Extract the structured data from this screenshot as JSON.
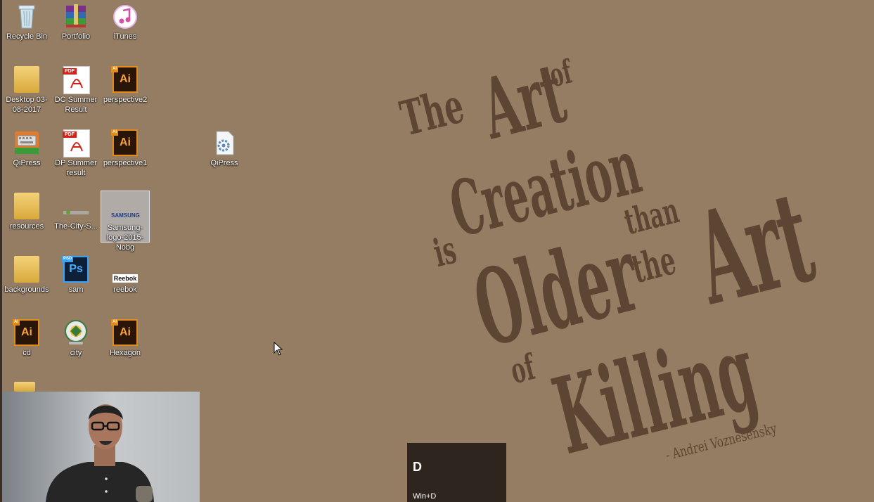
{
  "desktop": {
    "icons": [
      {
        "label": "Recycle Bin",
        "icon": "recycle-bin-icon"
      },
      {
        "label": "Portfolio",
        "icon": "winrar-archive-icon"
      },
      {
        "label": "iTunes",
        "icon": "itunes-icon"
      },
      {
        "label": "Desktop 03-08-2017",
        "icon": "folder-icon"
      },
      {
        "label": "DC Summer Result",
        "icon": "pdf-file-icon",
        "tag": "PDF"
      },
      {
        "label": "perspective2",
        "icon": "illustrator-file-icon",
        "tag": "AI",
        "glyph": "Ai"
      },
      {
        "label": "QiPress",
        "icon": "keyboard-app-icon"
      },
      {
        "label": "DP Summer result",
        "icon": "pdf-file-icon",
        "tag": "PDF"
      },
      {
        "label": "perspective1",
        "icon": "illustrator-file-icon",
        "tag": "AI",
        "glyph": "Ai"
      },
      {
        "label": "QiPress",
        "icon": "settings-file-icon"
      },
      {
        "label": "resources",
        "icon": "folder-icon"
      },
      {
        "label": "The-City-S...",
        "icon": "image-thumbnail-icon"
      },
      {
        "label": "Samsung-logo-2015-Nobg",
        "icon": "samsung-logo-thumbnail-icon",
        "thumb_text": "SAMSUNG"
      },
      {
        "label": "backgrounds",
        "icon": "folder-icon"
      },
      {
        "label": "sam",
        "icon": "photoshop-file-icon",
        "tag": "PSD",
        "glyph": "Ps"
      },
      {
        "label": "reebok",
        "icon": "reebok-logo-thumbnail-icon",
        "thumb_text": "Reebok"
      },
      {
        "label": "cd",
        "icon": "illustrator-file-icon",
        "tag": "AI",
        "glyph": "Ai"
      },
      {
        "label": "city",
        "icon": "city-logo-icon"
      },
      {
        "label": "Hexagon",
        "icon": "illustrator-file-icon",
        "tag": "AI",
        "glyph": "Ai"
      }
    ]
  },
  "wallpaper": {
    "words": [
      "The",
      "Art",
      "of",
      "Creation",
      "is",
      "Older",
      "than",
      "the",
      "Art",
      "of",
      "Killing"
    ],
    "author": "- Andrei Voznesensky"
  },
  "shortcut_tip": {
    "key": "D",
    "combo": "Win+D"
  },
  "colors": {
    "wallpaper": "#957d63",
    "text": "#5c4533",
    "tip_bg": "#2e251f"
  }
}
